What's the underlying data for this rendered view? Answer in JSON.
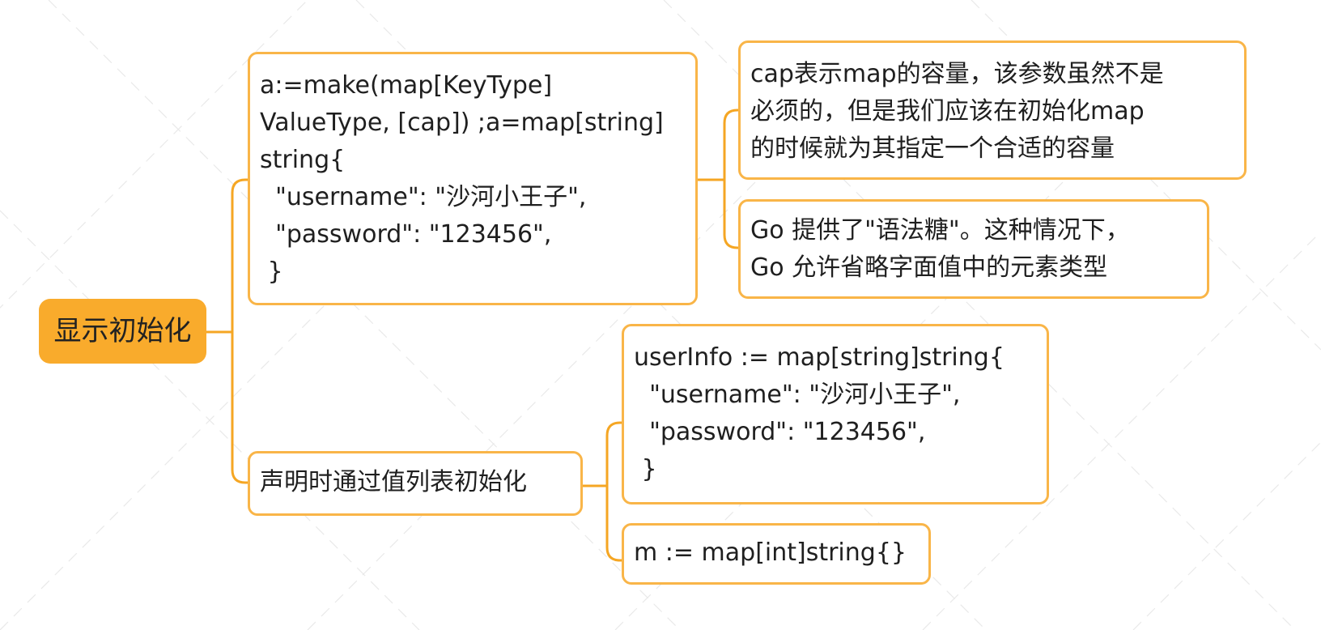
{
  "root": {
    "label": "显示初始化"
  },
  "branch1": {
    "code": "a:=make(map[KeyType]\nValueType, [cap]) ;a=map[string]\nstring{\n  \"username\": \"沙河小王子\",\n  \"password\": \"123456\",\n }",
    "note_capacity": "cap表示map的容量，该参数虽然不是\n必须的，但是我们应该在初始化map\n的时候就为其指定一个合适的容量",
    "note_sugar": "Go 提供了\"语法糖\"。这种情况下，\nGo 允许省略字面值中的元素类型"
  },
  "branch2": {
    "label": "声明时通过值列表初始化",
    "example_userinfo": "userInfo := map[string]string{\n  \"username\": \"沙河小王子\",\n  \"password\": \"123456\",\n }",
    "example_empty": "m := map[int]string{}"
  },
  "colors": {
    "accent": "#f9ab2c",
    "border": "#f9b548",
    "line": "#f5a623"
  }
}
